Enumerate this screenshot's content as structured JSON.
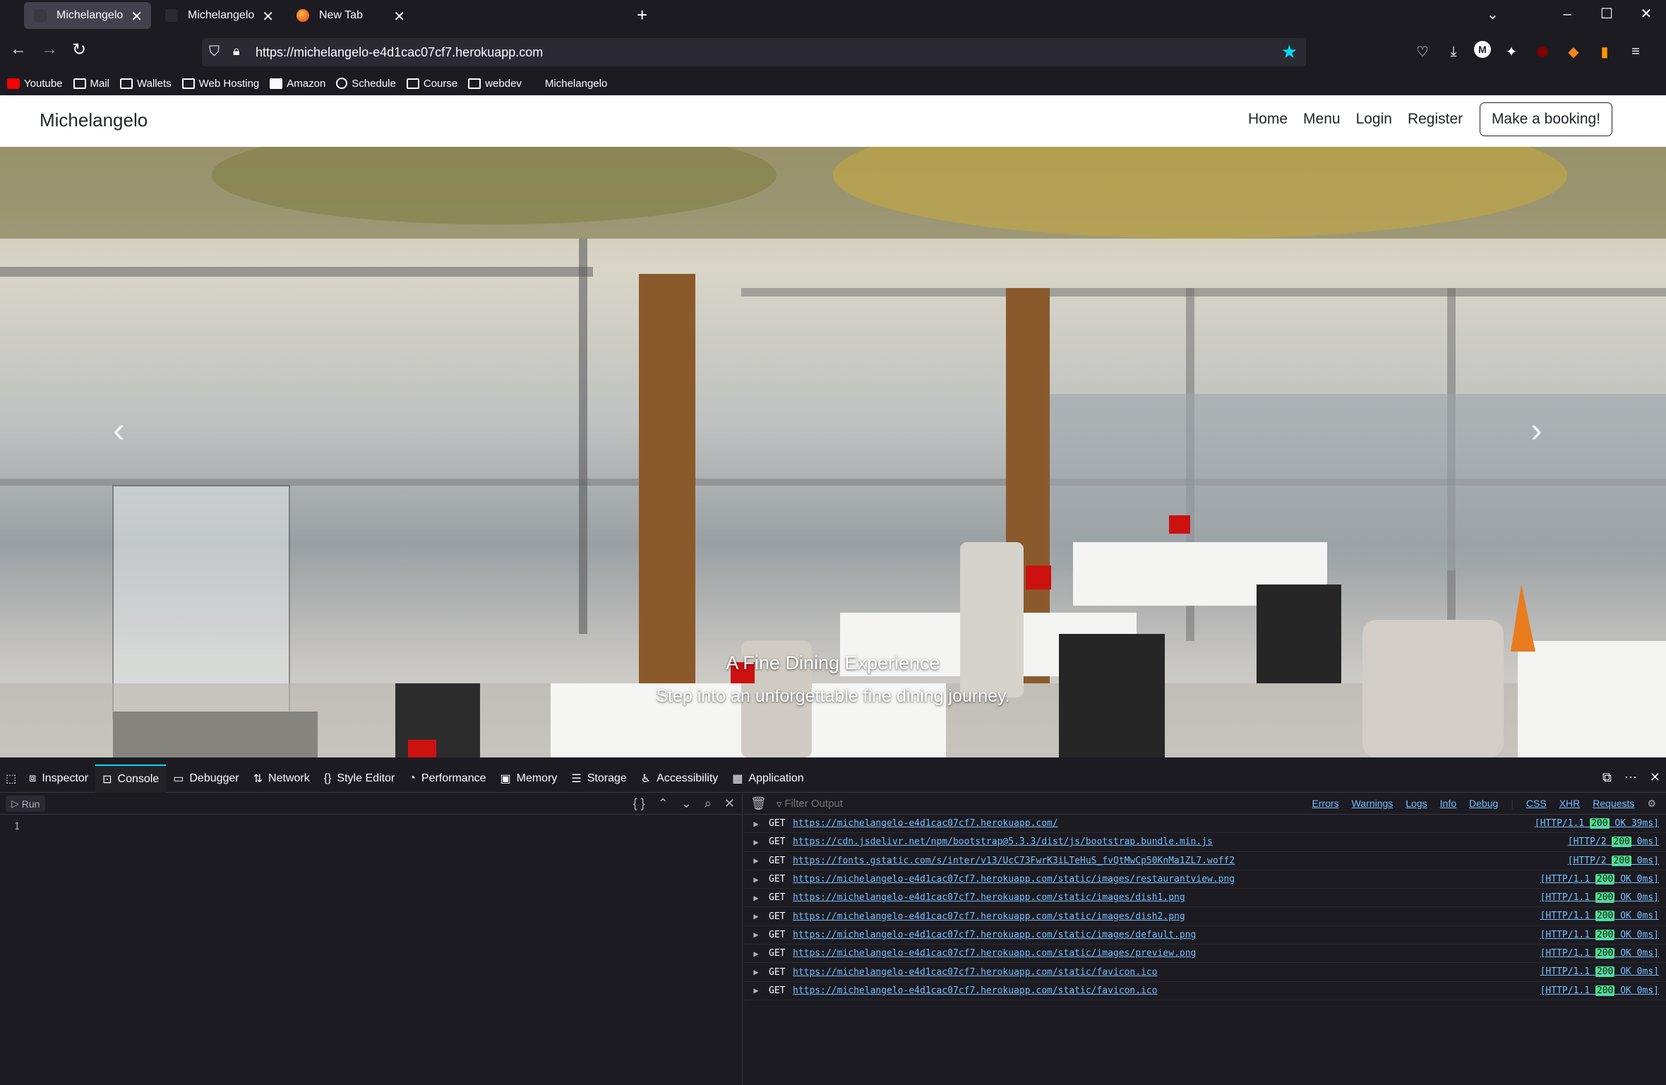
{
  "browser": {
    "tabs": [
      {
        "label": "Michelangelo",
        "active": true
      },
      {
        "label": "Michelangelo",
        "active": false
      },
      {
        "label": "New Tab",
        "active": false
      }
    ],
    "url": "https://michelangelo-e4d1cac07cf7.herokuapp.com",
    "bookmarks": [
      "Youtube",
      "Mail",
      "Wallets",
      "Web Hosting",
      "Amazon",
      "Schedule",
      "Course",
      "webdev",
      "Michelangelo"
    ]
  },
  "site": {
    "brand": "Michelangelo",
    "nav": [
      "Home",
      "Menu",
      "Login",
      "Register"
    ],
    "cta": "Make a booking!",
    "hero": {
      "title": "A Fine Dining Experience",
      "subtitle": "Step into an unforgettable fine dining journey."
    }
  },
  "devtools": {
    "tabs": [
      "Inspector",
      "Console",
      "Debugger",
      "Network",
      "Style Editor",
      "Performance",
      "Memory",
      "Storage",
      "Accessibility",
      "Application"
    ],
    "active_tab": "Console",
    "run_label": "Run",
    "line_number": "1",
    "filter_placeholder": "Filter Output",
    "filters": [
      "Errors",
      "Warnings",
      "Logs",
      "Info",
      "Debug",
      "CSS",
      "XHR",
      "Requests"
    ],
    "logs": [
      {
        "method": "GET",
        "url": "https://michelangelo-e4d1cac07cf7.herokuapp.com/",
        "proto": "[HTTP/1.1",
        "code": "200",
        "tail": "OK 39ms]"
      },
      {
        "method": "GET",
        "url": "https://cdn.jsdelivr.net/npm/bootstrap@5.3.3/dist/js/bootstrap.bundle.min.js",
        "proto": "[HTTP/2",
        "code": "200",
        "tail": "0ms]"
      },
      {
        "method": "GET",
        "url": "https://fonts.gstatic.com/s/inter/v13/UcC73FwrK3iLTeHuS_fvQtMwCp50KnMa1ZL7.woff2",
        "proto": "[HTTP/2",
        "code": "200",
        "tail": "0ms]"
      },
      {
        "method": "GET",
        "url": "https://michelangelo-e4d1cac07cf7.herokuapp.com/static/images/restaurantview.png",
        "proto": "[HTTP/1.1",
        "code": "200",
        "tail": "OK 0ms]"
      },
      {
        "method": "GET",
        "url": "https://michelangelo-e4d1cac07cf7.herokuapp.com/static/images/dish1.png",
        "proto": "[HTTP/1.1",
        "code": "200",
        "tail": "OK 0ms]"
      },
      {
        "method": "GET",
        "url": "https://michelangelo-e4d1cac07cf7.herokuapp.com/static/images/dish2.png",
        "proto": "[HTTP/1.1",
        "code": "200",
        "tail": "OK 0ms]"
      },
      {
        "method": "GET",
        "url": "https://michelangelo-e4d1cac07cf7.herokuapp.com/static/images/default.png",
        "proto": "[HTTP/1.1",
        "code": "200",
        "tail": "OK 0ms]"
      },
      {
        "method": "GET",
        "url": "https://michelangelo-e4d1cac07cf7.herokuapp.com/static/images/preview.png",
        "proto": "[HTTP/1.1",
        "code": "200",
        "tail": "OK 0ms]"
      },
      {
        "method": "GET",
        "url": "https://michelangelo-e4d1cac07cf7.herokuapp.com/static/favicon.ico",
        "proto": "[HTTP/1.1",
        "code": "200",
        "tail": "OK 0ms]"
      },
      {
        "method": "GET",
        "url": "https://michelangelo-e4d1cac07cf7.herokuapp.com/static/favicon.ico",
        "proto": "[HTTP/1.1",
        "code": "200",
        "tail": "OK 0ms]"
      }
    ]
  },
  "icons": {
    "tab_close": "close-icon",
    "new_tab": "plus-icon",
    "back": "back-arrow-icon",
    "forward": "forward-arrow-icon",
    "reload": "reload-icon",
    "bookmark_star": "star-icon",
    "carousel_prev": "chevron-left-icon",
    "carousel_next": "chevron-right-icon"
  },
  "colors": {
    "chrome_bg": "#1c1b22",
    "tab_active": "#42414d",
    "url_bg": "#2b2a33",
    "accent": "#00ddff",
    "link": "#75bfff",
    "status_ok": "#4bdf8a"
  }
}
